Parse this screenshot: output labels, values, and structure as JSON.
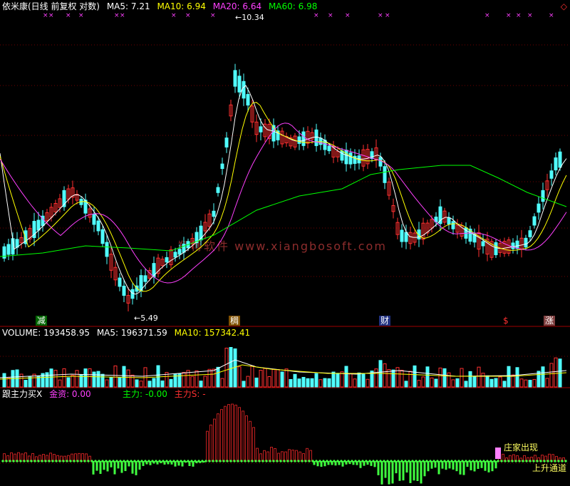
{
  "main": {
    "title": "依米康(日线 前复权 对数)",
    "ma5": "MA5: 7.21",
    "ma10": "MA10: 6.94",
    "ma20": "MA20: 6.64",
    "ma60": "MA60: 6.98",
    "high_label": "10.34",
    "low_label": "5.49",
    "tags": {
      "jian": "减",
      "chou": "稠",
      "cai": "财",
      "s": "$",
      "zhang": "涨"
    }
  },
  "volume": {
    "label": "VOLUME: 193458.95",
    "ma5": "MA5: 196371.59",
    "ma10": "MA10: 157342.41"
  },
  "indicator": {
    "name": "跟主力买X",
    "jinzi": "金资: 0.00",
    "zhuli": "主力: -0.00",
    "zhuli_s": "主力S: -",
    "callout_1": "庄家出现",
    "callout_2": "上升通道"
  },
  "watermark": "翔博软件 www.xiangbosoft.com",
  "colors": {
    "up": "#ff3030",
    "down": "#50ffff",
    "ma5": "#ffffff",
    "ma10": "#ffff00",
    "ma20": "#ff40ff",
    "ma60": "#00ff00"
  }
}
